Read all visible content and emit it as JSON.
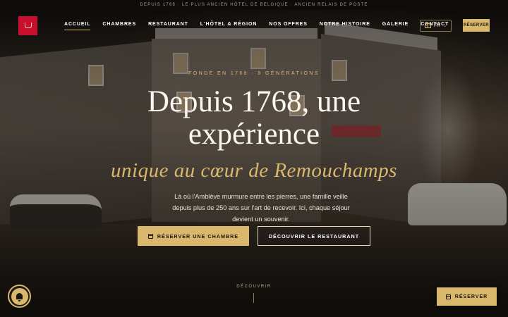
{
  "topbar": {
    "text": "DEPUIS 1768 · LE PLUS ANCIEN HÔTEL DE BELGIQUE · ANCIEN RELAIS DE POSTE"
  },
  "nav": {
    "items": [
      {
        "label": "ACCUEIL",
        "active": true
      },
      {
        "label": "CHAMBRES"
      },
      {
        "label": "RESTAURANT"
      },
      {
        "label": "L'HÔTEL & RÉGION"
      },
      {
        "label": "NOS OFFRES"
      },
      {
        "label": "NOTRE HISTOIRE"
      },
      {
        "label": "GALERIE"
      },
      {
        "label": "CONTACT"
      }
    ],
    "language": "FR",
    "reserve_label": "RÉSERVER"
  },
  "hero": {
    "eyebrow": "FONDÉ EN 1768 · 8 GÉNÉRATIONS",
    "headline": "Depuis 1768, une expérience",
    "headline_italic": "unique au cœur de Remouchamps",
    "lead": "Là où l'Amblève murmure entre les pierres, une famille veille depuis plus de 250 ans sur l'art de recevoir. Ici, chaque séjour devient un souvenir.",
    "primary_button": "RÉSERVER UNE CHAMBRE",
    "secondary_button": "DÉCOUVRIR LE RESTAURANT",
    "scroll_label": "DÉCOUVRIR"
  },
  "floating": {
    "reserve_label": "RÉSERVER"
  },
  "colors": {
    "accent": "#d9b86c",
    "brand": "#c8102e"
  }
}
